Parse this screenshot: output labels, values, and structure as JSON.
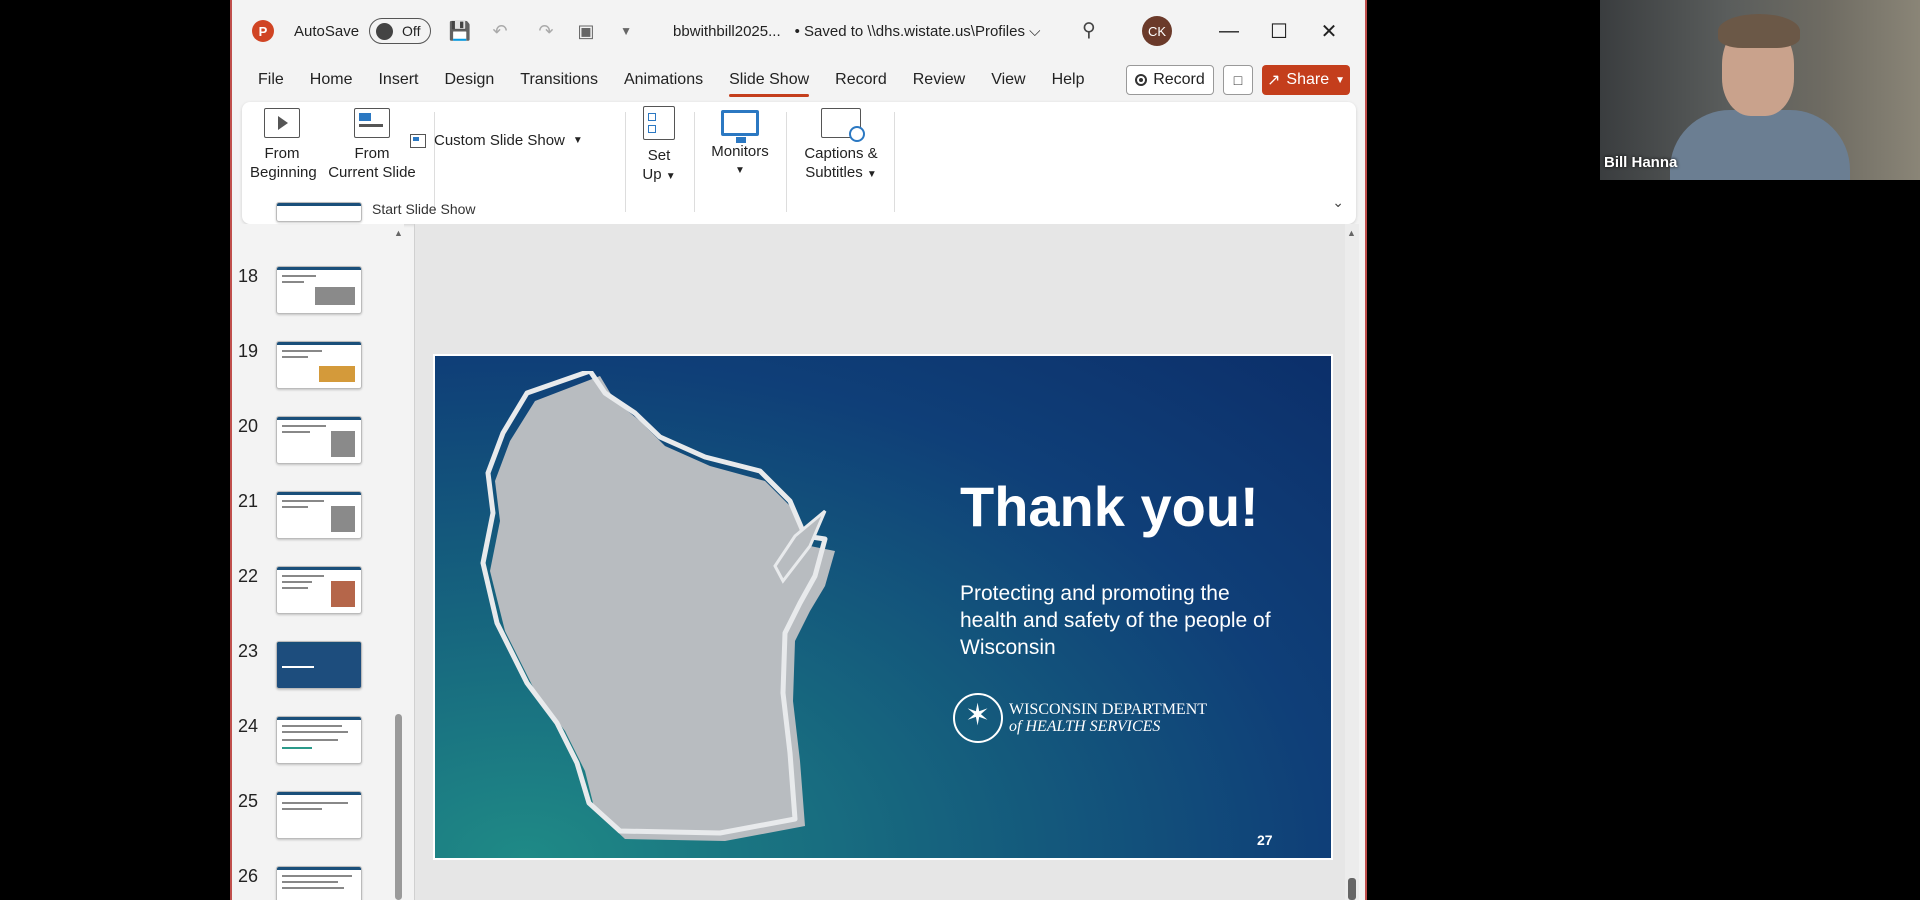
{
  "titlebar": {
    "app_logo": "P",
    "autosave_label": "AutoSave",
    "autosave_state": "Off",
    "filename": "bbwithbill2025...",
    "saved_status": "• Saved to \\\\dhs.wistate.us\\Profiles ⌵",
    "user_initials": "CK",
    "icons": [
      "save-icon",
      "undo-icon",
      "redo-icon",
      "present-icon",
      "customize-icon",
      "search-icon",
      "minimize-icon",
      "maximize-icon",
      "close-icon"
    ]
  },
  "menu": {
    "tabs": [
      "File",
      "Home",
      "Insert",
      "Design",
      "Transitions",
      "Animations",
      "Slide Show",
      "Record",
      "Review",
      "View",
      "Help"
    ],
    "active_tab": "Slide Show",
    "record_label": "Record",
    "share_label": "Share",
    "accent_color": "#c43e1c"
  },
  "ribbon": {
    "from_beginning_line1": "From",
    "from_beginning_line2": "Beginning",
    "from_current_line1": "From",
    "from_current_line2": "Current Slide",
    "custom_slide_show": "Custom Slide Show",
    "set_up_line1": "Set",
    "set_up_line2": "Up",
    "monitors": "Monitors",
    "captions_line1": "Captions &",
    "captions_line2": "Subtitles",
    "group_label": "Start Slide Show"
  },
  "thumbnails": {
    "numbers": [
      "18",
      "19",
      "20",
      "21",
      "22",
      "23",
      "24",
      "25",
      "26"
    ]
  },
  "slide": {
    "title": "Thank you!",
    "subtitle": "Protecting and promoting the health and safety of the people of Wisconsin",
    "logo_line1": "WISCONSIN DEPARTMENT",
    "logo_line2": "of HEALTH SERVICES",
    "number": "27"
  },
  "webcam": {
    "name": "Bill Hanna"
  }
}
